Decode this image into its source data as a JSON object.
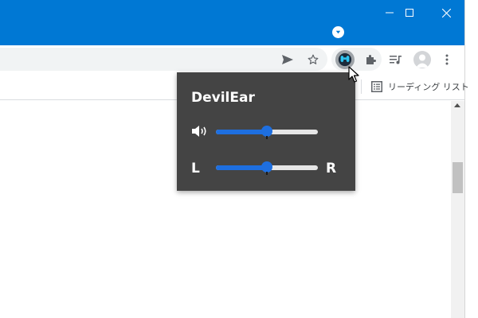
{
  "window": {
    "minimize_icon": "minimize-icon",
    "maximize_icon": "maximize-icon",
    "close_icon": "close-icon"
  },
  "toolbar": {
    "icons": [
      "send-icon",
      "star-icon",
      "devilear-extension-icon",
      "puzzle-icon",
      "playlist-icon",
      "avatar",
      "more-menu-icon"
    ]
  },
  "bookmarks": {
    "reading_list_label": "リーディング リスト"
  },
  "popup": {
    "title": "DevilEar",
    "volume_level": 0.5,
    "balance_level": 0.5,
    "left_label": "L",
    "right_label": "R"
  },
  "colors": {
    "titlebar": "#0078d4",
    "popup_bg": "#444444",
    "slider_accent": "#1e6fe0"
  }
}
